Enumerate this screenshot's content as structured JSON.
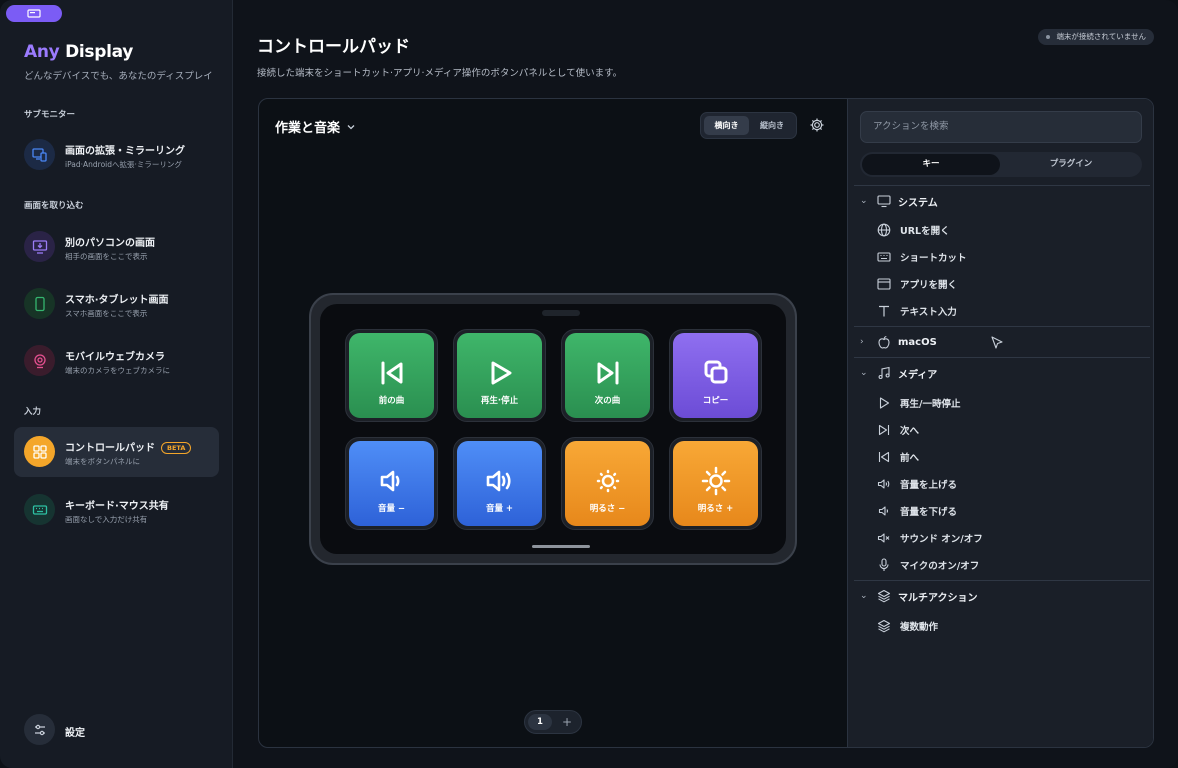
{
  "sidebar": {
    "brand_any": "Any",
    "brand_display": "Display",
    "tagline": "どんなデバイスでも、あなたのディスプレイ",
    "sections": [
      {
        "label": "サブモニター"
      },
      {
        "label": "画面を取り込む"
      },
      {
        "label": "入力"
      }
    ],
    "items": [
      {
        "title": "画面の拡張・ミラーリング",
        "subtitle": "iPad·Androidへ拡張·ミラーリング",
        "icon": "monitor-tablet-icon",
        "color": "#3a78f0"
      },
      {
        "title": "別のパソコンの画面",
        "subtitle": "相手の画面をここで表示",
        "icon": "desktop-download-icon",
        "color": "#8b6cf0"
      },
      {
        "title": "スマホ·タブレット画面",
        "subtitle": "スマホ画面をここで表示",
        "icon": "phone-icon",
        "color": "#2fb36b"
      },
      {
        "title": "モバイルウェブカメラ",
        "subtitle": "端末のカメラをウェブカメラに",
        "icon": "webcam-icon",
        "color": "#e0488a"
      },
      {
        "title": "コントロールパッド",
        "subtitle": "端末をボタンパネルに",
        "badge": "BETA",
        "icon": "grid-icon",
        "color": "#f4a62a",
        "active": true
      },
      {
        "title": "キーボード·マウス共有",
        "subtitle": "画面なしで入力だけ共有",
        "icon": "keyboard-icon",
        "color": "#2bb39a"
      }
    ],
    "settings_label": "設定"
  },
  "header": {
    "title": "コントロールパッド",
    "description": "接続した端末をショートカット·アプリ·メディア操作のボタンパネルとして使います。",
    "connection_status": "端末が接続されていません"
  },
  "editor": {
    "profile_name": "作業と音楽",
    "orientation": {
      "landscape": "横向き",
      "portrait": "縦向き",
      "selected": "横向き"
    },
    "keys": [
      {
        "label": "前の曲",
        "icon": "previous-track-icon",
        "color": "green"
      },
      {
        "label": "再生·停止",
        "icon": "play-icon",
        "color": "green"
      },
      {
        "label": "次の曲",
        "icon": "next-track-icon",
        "color": "green"
      },
      {
        "label": "コピー",
        "icon": "copy-icon",
        "color": "purple"
      },
      {
        "label": "音量 −",
        "icon": "volume-down-icon",
        "color": "blue"
      },
      {
        "label": "音量 +",
        "icon": "volume-up-icon",
        "color": "blue"
      },
      {
        "label": "明るさ −",
        "icon": "brightness-down-icon",
        "color": "orange"
      },
      {
        "label": "明るさ +",
        "icon": "brightness-up-icon",
        "color": "orange"
      }
    ],
    "page": "1",
    "add_page": "+"
  },
  "actions": {
    "search_placeholder": "アクションを検索",
    "tabs": [
      "キー",
      "プラグイン"
    ],
    "active_tab": "キー",
    "categories": [
      {
        "name": "システム",
        "expanded": true,
        "items": [
          "URLを開く",
          "ショートカット",
          "アプリを開く",
          "テキスト入力"
        ]
      },
      {
        "name": "macOS",
        "expanded": false,
        "items": []
      },
      {
        "name": "メディア",
        "expanded": true,
        "items": [
          "再生/一時停止",
          "次へ",
          "前へ",
          "音量を上げる",
          "音量を下げる",
          "サウンド オン/オフ",
          "マイクのオン/オフ"
        ]
      },
      {
        "name": "マルチアクション",
        "expanded": true,
        "items": [
          "複数動作"
        ]
      }
    ]
  }
}
